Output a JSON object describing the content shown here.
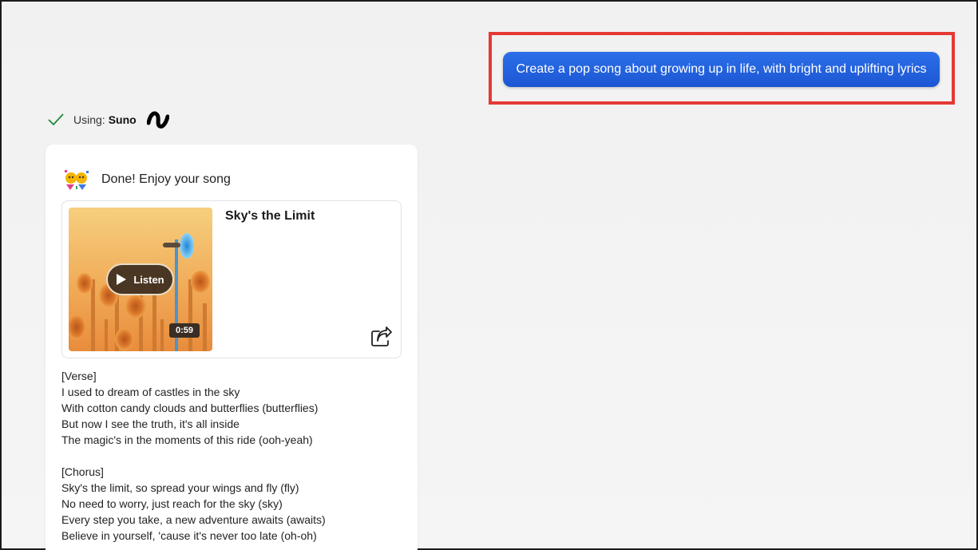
{
  "prompt": {
    "text": "Create a pop song about growing up in life, with bright and uplifting lyrics"
  },
  "using": {
    "label": "Using:",
    "name": "Suno",
    "status_icon": "check-icon",
    "brand_icon": "suno-logo-icon"
  },
  "response": {
    "status_icon": "party-popper-icon",
    "done_text": "Done! Enjoy your song",
    "song": {
      "title": "Sky's the Limit",
      "listen_label": "Listen",
      "duration": "0:59",
      "share_icon": "share-icon"
    },
    "lyrics": {
      "verse_header": "[Verse]",
      "verse": [
        "I used to dream of castles in the sky",
        "With cotton candy clouds and butterflies (butterflies)",
        "But now I see the truth, it's all inside",
        "The magic's in the moments of this ride (ooh-yeah)"
      ],
      "chorus_header": "[Chorus]",
      "chorus": [
        "Sky's the limit, so spread your wings and fly (fly)",
        "No need to worry, just reach for the sky (sky)",
        "Every step you take, a new adventure awaits (awaits)",
        "Believe in yourself, 'cause it's never too late (oh-oh)"
      ]
    }
  },
  "colors": {
    "accent_blue": "#1d56d4",
    "highlight_red": "#e53935",
    "check_green": "#1e8a3a"
  }
}
